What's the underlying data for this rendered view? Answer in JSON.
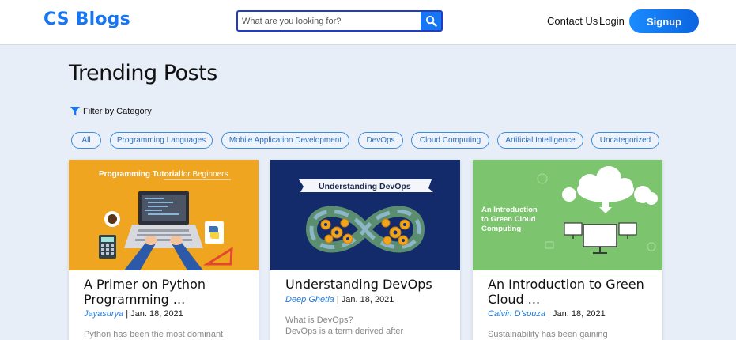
{
  "brand": "CS Blogs",
  "search": {
    "placeholder": "What are you looking for?"
  },
  "nav": {
    "contact": "Contact Us",
    "login": "Login",
    "signup": "Signup"
  },
  "page_title": "Trending Posts",
  "filter_label": "Filter by Category",
  "categories": [
    "All",
    "Programming Languages",
    "Mobile Application Development",
    "DevOps",
    "Cloud Computing",
    "Artificial Intelligence",
    "Uncategorized"
  ],
  "posts": [
    {
      "title": "A Primer on Python Programming ...",
      "author": "Jayasurya",
      "date": "Jan. 18, 2021",
      "excerpt": "Python has been the most dominant",
      "image_text": {
        "main": "Programming Tutorial",
        "accent": "for Beginners"
      }
    },
    {
      "title": "Understanding DevOps",
      "author": "Deep Ghetia",
      "date": "Jan. 18, 2021",
      "excerpt": "What is DevOps?",
      "excerpt2": "DevOps is a term derived after",
      "image_text": {
        "main": "Understanding DevOps"
      }
    },
    {
      "title": "An Introduction to Green Cloud ...",
      "author": "Calvin D'souza",
      "date": "Jan. 18, 2021",
      "excerpt": "Sustainability has been gaining",
      "image_text": {
        "line1": "An Introduction",
        "line2": "to Green Cloud",
        "line3": "Computing"
      }
    }
  ],
  "colors": {
    "brand": "#1676f3",
    "chip_border": "#3a8de0",
    "author": "#1f7ad8"
  }
}
